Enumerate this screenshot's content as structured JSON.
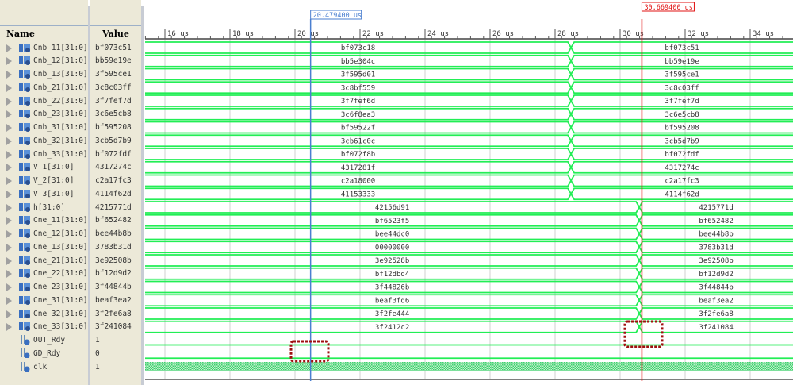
{
  "headers": {
    "name": "Name",
    "value": "Value"
  },
  "time_unit": "us",
  "ticks": [
    "16 us",
    "18 us",
    "20 us",
    "22 us",
    "24 us",
    "26 us",
    "28 us",
    "30 us",
    "32 us",
    "34 us"
  ],
  "tick_times": [
    16,
    18,
    20,
    22,
    24,
    26,
    28,
    30,
    32,
    34
  ],
  "cursors": [
    {
      "label": "20.479400 us",
      "time": 20.4794,
      "color": "#4a7fd0"
    },
    {
      "label": "30.669400 us",
      "time": 30.6694,
      "color": "#e01010"
    }
  ],
  "signals": [
    {
      "name": "Cnb_11[31:0]",
      "value": "bf073c51",
      "type": "bus",
      "t": 28.49,
      "before": "bf073c18",
      "after": "bf073c51"
    },
    {
      "name": "Cnb_12[31:0]",
      "value": "bb59e19e",
      "type": "bus",
      "t": 28.49,
      "before": "bb5e304c",
      "after": "bb59e19e"
    },
    {
      "name": "Cnb_13[31:0]",
      "value": "3f595ce1",
      "type": "bus",
      "t": 28.49,
      "before": "3f595d01",
      "after": "3f595ce1"
    },
    {
      "name": "Cnb_21[31:0]",
      "value": "3c8c03ff",
      "type": "bus",
      "t": 28.49,
      "before": "3c8bf559",
      "after": "3c8c03ff"
    },
    {
      "name": "Cnb_22[31:0]",
      "value": "3f7fef7d",
      "type": "bus",
      "t": 28.49,
      "before": "3f7fef6d",
      "after": "3f7fef7d"
    },
    {
      "name": "Cnb_23[31:0]",
      "value": "3c6e5cb8",
      "type": "bus",
      "t": 28.49,
      "before": "3c6f8ea3",
      "after": "3c6e5cb8"
    },
    {
      "name": "Cnb_31[31:0]",
      "value": "bf595208",
      "type": "bus",
      "t": 28.49,
      "before": "bf59522f",
      "after": "bf595208"
    },
    {
      "name": "Cnb_32[31:0]",
      "value": "3cb5d7b9",
      "type": "bus",
      "t": 28.49,
      "before": "3cb61c0c",
      "after": "3cb5d7b9"
    },
    {
      "name": "Cnb_33[31:0]",
      "value": "bf072fdf",
      "type": "bus",
      "t": 28.49,
      "before": "bf072f8b",
      "after": "bf072fdf"
    },
    {
      "name": "V_1[31:0]",
      "value": "4317274c",
      "type": "bus",
      "t": 28.49,
      "before": "4317281f",
      "after": "4317274c"
    },
    {
      "name": "V_2[31:0]",
      "value": "c2a17fc3",
      "type": "bus",
      "t": 28.49,
      "before": "c2a18000",
      "after": "c2a17fc3"
    },
    {
      "name": "V_3[31:0]",
      "value": "4114f62d",
      "type": "bus",
      "t": 28.49,
      "before": "41153333",
      "after": "4114f62d"
    },
    {
      "name": "h[31:0]",
      "value": "4215771d",
      "type": "bus",
      "t": 30.59,
      "before": "42156d91",
      "after": "4215771d"
    },
    {
      "name": "Cne_11[31:0]",
      "value": "bf652482",
      "type": "bus",
      "t": 30.59,
      "before": "bf6523f5",
      "after": "bf652482"
    },
    {
      "name": "Cne_12[31:0]",
      "value": "bee44b8b",
      "type": "bus",
      "t": 30.59,
      "before": "bee44dc0",
      "after": "bee44b8b"
    },
    {
      "name": "Cne_13[31:0]",
      "value": "3783b31d",
      "type": "bus",
      "t": 30.59,
      "before": "00000000",
      "after": "3783b31d"
    },
    {
      "name": "Cne_21[31:0]",
      "value": "3e92508b",
      "type": "bus",
      "t": 30.59,
      "before": "3e92528b",
      "after": "3e92508b"
    },
    {
      "name": "Cne_22[31:0]",
      "value": "bf12d9d2",
      "type": "bus",
      "t": 30.59,
      "before": "bf12dbd4",
      "after": "bf12d9d2"
    },
    {
      "name": "Cne_23[31:0]",
      "value": "3f44844b",
      "type": "bus",
      "t": 30.59,
      "before": "3f44826b",
      "after": "3f44844b"
    },
    {
      "name": "Cne_31[31:0]",
      "value": "beaf3ea2",
      "type": "bus",
      "t": 30.59,
      "before": "beaf3fd6",
      "after": "beaf3ea2"
    },
    {
      "name": "Cne_32[31:0]",
      "value": "3f2fe6a8",
      "type": "bus",
      "t": 30.59,
      "before": "3f2fe444",
      "after": "3f2fe6a8"
    },
    {
      "name": "Cne_33[31:0]",
      "value": "3f241084",
      "type": "bus",
      "t": 30.59,
      "before": "3f2412c2",
      "after": "3f241084"
    },
    {
      "name": "OUT_Rdy",
      "value": "1",
      "type": "bit"
    },
    {
      "name": "GD_Rdy",
      "value": "0",
      "type": "bit"
    },
    {
      "name": "clk",
      "value": "1",
      "type": "clock"
    }
  ],
  "colors": {
    "wave": "#22ee55",
    "grid": "#d0d0d0",
    "highlight": "#a01010"
  }
}
